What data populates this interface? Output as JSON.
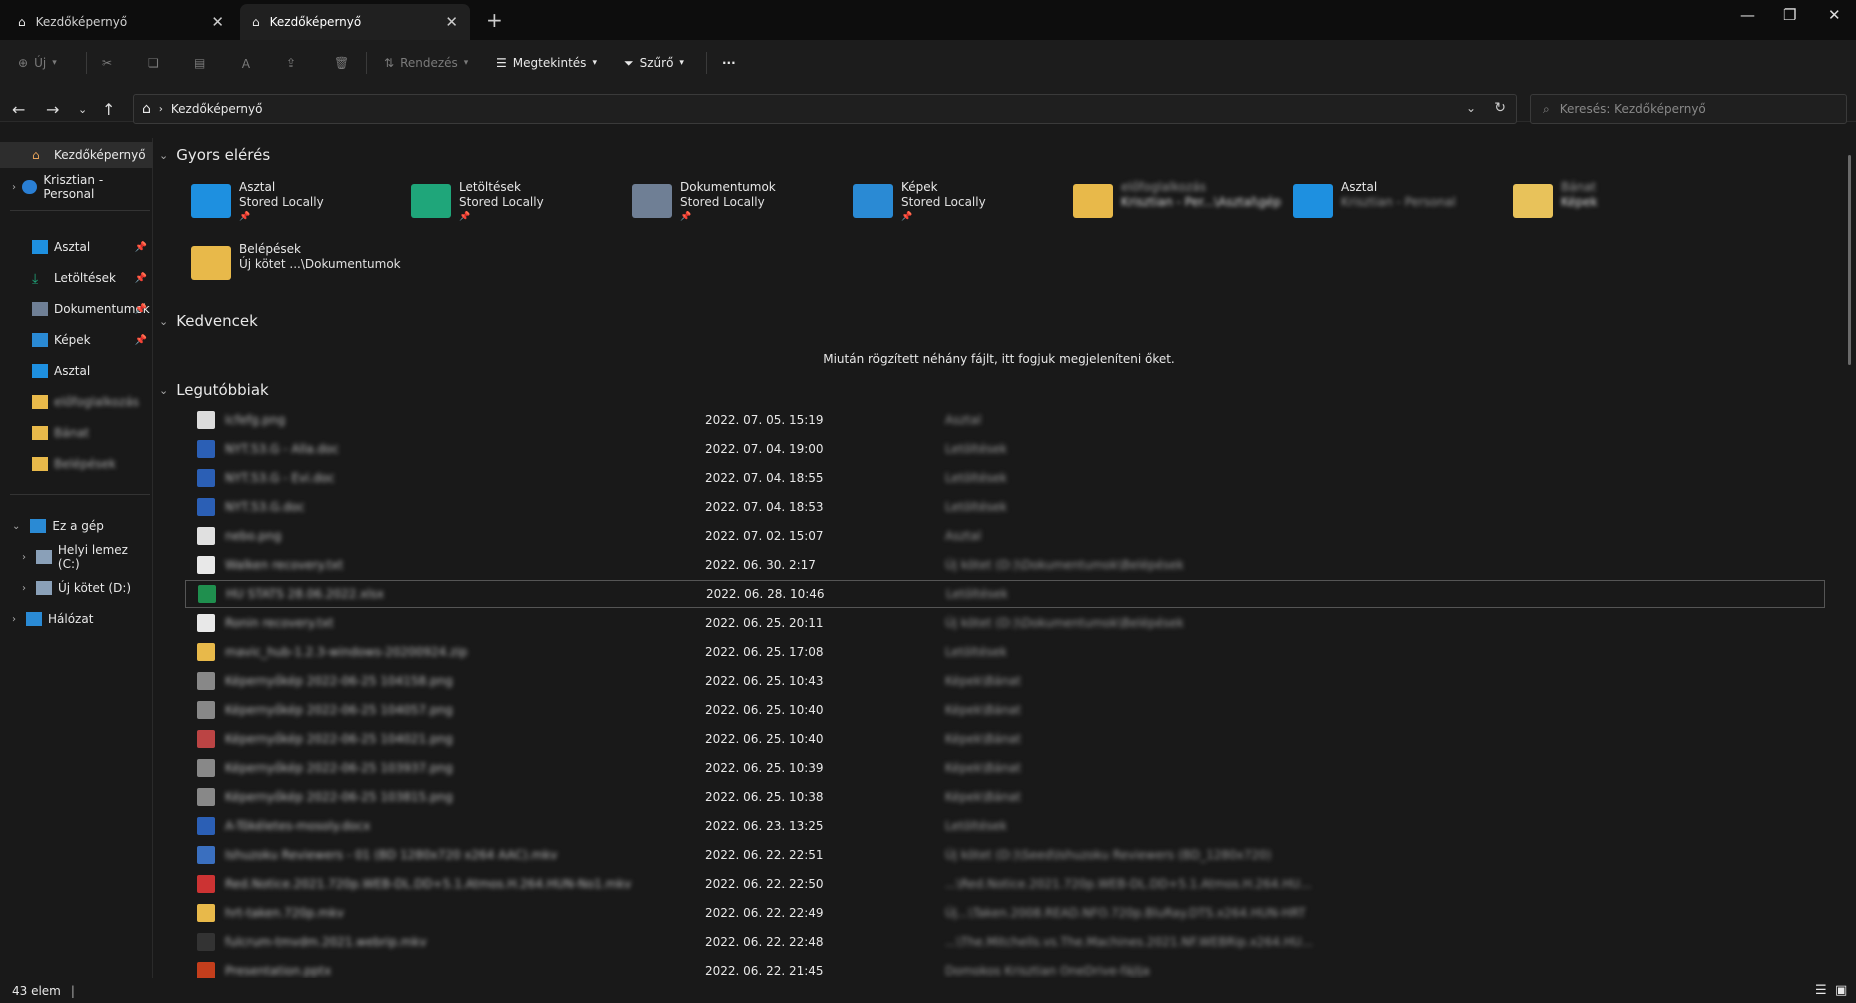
{
  "tabs": [
    {
      "label": "Kezdőképernyő",
      "active": false
    },
    {
      "label": "Kezdőképernyő",
      "active": true
    }
  ],
  "toolbar": {
    "new_label": "Új",
    "sort_label": "Rendezés",
    "view_label": "Megtekintés",
    "filter_label": "Szűrő",
    "more_label": "···"
  },
  "address": {
    "path": "Kezdőképernyő",
    "search_placeholder": "Keresés: Kezdőképernyő"
  },
  "sidebar": {
    "home": "Kezdőképernyő",
    "onedrive": "Krisztian - Personal",
    "pinned": [
      {
        "label": "Asztal"
      },
      {
        "label": "Letöltések"
      },
      {
        "label": "Dokumentumok"
      },
      {
        "label": "Képek"
      }
    ],
    "others": [
      {
        "label": "Asztal"
      },
      {
        "label": "előfoglalkozás"
      },
      {
        "label": "Bánat"
      },
      {
        "label": "Belépések"
      }
    ],
    "this_pc": "Ez a gép",
    "drives": [
      {
        "label": "Helyi lemez (C:)"
      },
      {
        "label": "Új kötet (D:)"
      }
    ],
    "network": "Hálózat"
  },
  "sections": {
    "quick_access": "Gyors elérés",
    "favorites": "Kedvencek",
    "recent": "Legutóbbiak",
    "favorites_empty": "Miután rögzített néhány fájlt, itt fogjuk megjeleníteni őket."
  },
  "quick_access": [
    {
      "name": "Asztal",
      "sub": "Stored Locally",
      "color": "#1e90e0"
    },
    {
      "name": "Letöltések",
      "sub": "Stored Locally",
      "color": "#1fa67a"
    },
    {
      "name": "Dokumentumok",
      "sub": "Stored Locally",
      "color": "#6f7f95"
    },
    {
      "name": "Képek",
      "sub": "Stored Locally",
      "color": "#2a8ad4"
    },
    {
      "name": "előfoglalkozás",
      "sub": "Krisztian - Per...\\Asztal\\gép",
      "color": "#e8b94a"
    },
    {
      "name": "Asztal",
      "sub": "Krisztian - Personal",
      "color": "#1e90e0"
    },
    {
      "name": "Bánat",
      "sub": "Képek",
      "color": "#e8c25a"
    },
    {
      "name": "Belépések",
      "sub": "Új kötet ...\\Dokumentumok",
      "color": "#e8b94a"
    }
  ],
  "recent": [
    {
      "name": "Icfefg.png",
      "date": "2022. 07. 05. 15:19",
      "loc": "Asztal"
    },
    {
      "name": "NYT.53.G - Alla.doc",
      "date": "2022. 07. 04. 19:00",
      "loc": "Letöltések"
    },
    {
      "name": "NYT.53.G - Evi.doc",
      "date": "2022. 07. 04. 18:55",
      "loc": "Letöltések"
    },
    {
      "name": "NYT.53.G.doc",
      "date": "2022. 07. 04. 18:53",
      "loc": "Letöltések"
    },
    {
      "name": "nebo.png",
      "date": "2022. 07. 02. 15:07",
      "loc": "Asztal"
    },
    {
      "name": "Walken recovery.txt",
      "date": "2022. 06. 30. 2:17",
      "loc": "Új kötet (D:)\\Dokumentumok\\Belépések"
    },
    {
      "name": "HU STATS 28.06.2022.xlsx",
      "date": "2022. 06. 28. 10:46",
      "loc": "Letöltések"
    },
    {
      "name": "Ronin recovery.txt",
      "date": "2022. 06. 25. 20:11",
      "loc": "Új kötet (D:)\\Dokumentumok\\Belépések"
    },
    {
      "name": "mavic_hub-1.2.3-windows-20200924.zip",
      "date": "2022. 06. 25. 17:08",
      "loc": "Letöltések"
    },
    {
      "name": "Képernyőkép 2022-06-25 104158.png",
      "date": "2022. 06. 25. 10:43",
      "loc": "Képek\\Bánat"
    },
    {
      "name": "Képernyőkép 2022-06-25 104057.png",
      "date": "2022. 06. 25. 10:40",
      "loc": "Képek\\Bánat"
    },
    {
      "name": "Képernyőkép 2022-06-25 104021.png",
      "date": "2022. 06. 25. 10:40",
      "loc": "Képek\\Bánat"
    },
    {
      "name": "Képernyőkép 2022-06-25 103937.png",
      "date": "2022. 06. 25. 10:39",
      "loc": "Képek\\Bánat"
    },
    {
      "name": "Képernyőkép 2022-06-25 103815.png",
      "date": "2022. 06. 25. 10:38",
      "loc": "Képek\\Bánat"
    },
    {
      "name": "A-Tökéletes-mosoly.docx",
      "date": "2022. 06. 23. 13:25",
      "loc": "Letöltések"
    },
    {
      "name": "Ishuzoku Reviewers - 01 (BD 1280x720 x264 AAC).mkv",
      "date": "2022. 06. 22. 22:51",
      "loc": "Új kötet (D:)\\Seed\\Ishuzoku Reviewers (BD_1280x720)"
    },
    {
      "name": "Red.Notice.2021.720p.WEB-DL.DD+5.1.Atmos.H.264.HUN-No1.mkv",
      "date": "2022. 06. 22. 22:50",
      "loc": "...\\Red.Notice.2021.720p.WEB-DL.DD+5.1.Atmos.H.264.HU..."
    },
    {
      "name": "hrt-taken.720p.mkv",
      "date": "2022. 06. 22. 22:49",
      "loc": "Új...\\Taken.2008.READ.NFO.720p.BluRay.DTS.x264.HUN-HRT"
    },
    {
      "name": "fulcrum-tmvdm.2021.webrip.mkv",
      "date": "2022. 06. 22. 22:48",
      "loc": "...\\The.Mitchells.vs.The.Machines.2021.NF.WEBRip.x264.HU..."
    },
    {
      "name": "Presentation.pptx",
      "date": "2022. 06. 22. 21:45",
      "loc": "Domokos Krisztian OneDrive-fájlja"
    }
  ],
  "status": {
    "count": "43 elem"
  }
}
